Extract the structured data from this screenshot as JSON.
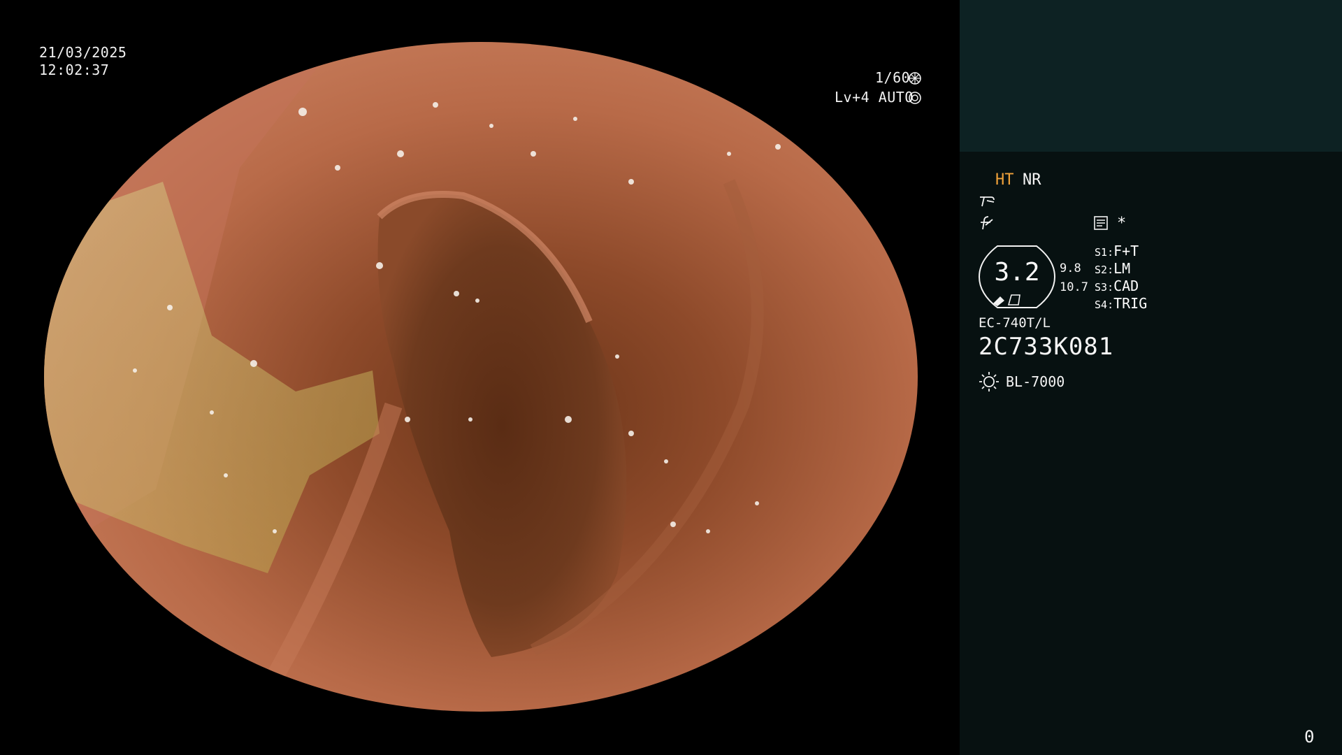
{
  "overlay": {
    "date": "21/03/2025",
    "time": "12:02:37",
    "shutter": "1/60",
    "level": "Lv+4 AUTO",
    "shutter_icon": "aperture-icon",
    "auto_icon": "iris-auto-icon"
  },
  "panel": {
    "mode_ht": "HT",
    "mode_nr": "NR",
    "enhance_icon": "structure-enhance-icon",
    "color_icon": "color-enhance-icon",
    "memory_icon": "memory-card-icon",
    "star": "*",
    "brightness": {
      "main": "3.2",
      "upper": "9.8",
      "lower": "10.7",
      "icon": "pen-mark-icon"
    },
    "switches": [
      {
        "key": "S1",
        "value": "F+T"
      },
      {
        "key": "S2",
        "value": "LM"
      },
      {
        "key": "S3",
        "value": "CAD"
      },
      {
        "key": "S4",
        "value": "TRIG"
      }
    ],
    "scope_model": "EC-740T/L",
    "scope_serial": "2C733K081",
    "light_icon": "sun-icon",
    "light_source": "BL-7000",
    "counter": "0"
  },
  "colors": {
    "accent": "#f0a23a",
    "panel_bg": "#071111",
    "panel_top_bg": "#0d2223"
  }
}
